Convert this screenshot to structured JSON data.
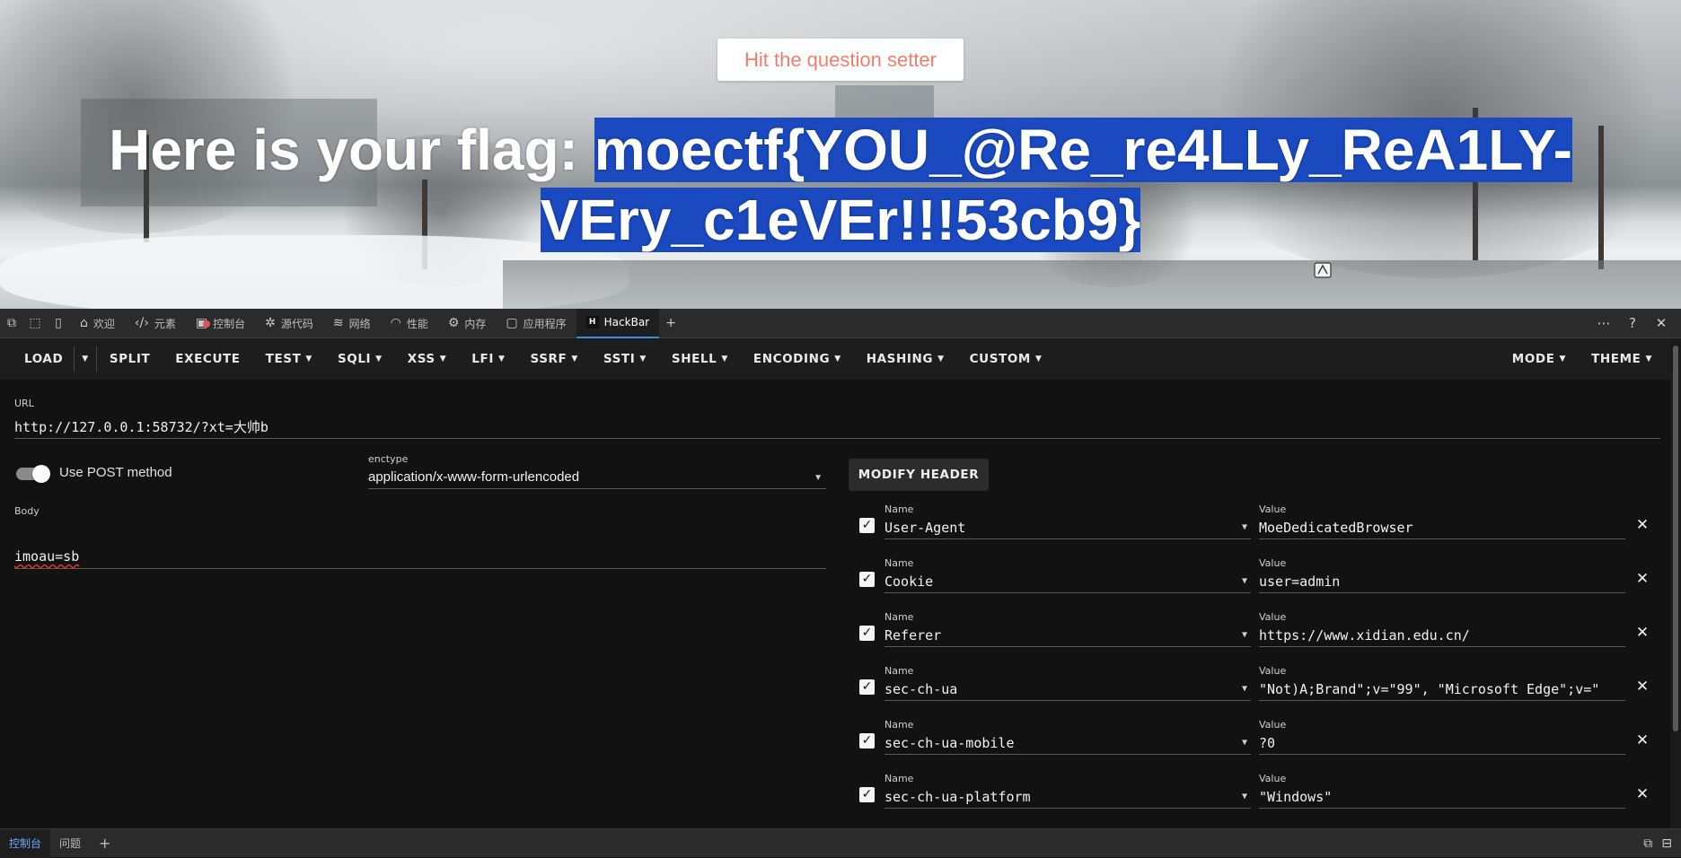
{
  "page": {
    "hit_button": "Hit the question setter",
    "flag_prefix": "Here is your flag: ",
    "flag_value_line1": "moectf{YOU_@Re_re4LLy_ReA1LY-",
    "flag_value_line2": "VEry_c1eVEr!!!53cb9}"
  },
  "devtools": {
    "tabs": [
      {
        "label": "欢迎",
        "icon": "home-icon"
      },
      {
        "label": "元素",
        "icon": "elements-icon"
      },
      {
        "label": "控制台",
        "icon": "console-icon"
      },
      {
        "label": "源代码",
        "icon": "sources-icon"
      },
      {
        "label": "网络",
        "icon": "wifi-icon"
      },
      {
        "label": "性能",
        "icon": "performance-icon"
      },
      {
        "label": "内存",
        "icon": "memory-icon"
      },
      {
        "label": "应用程序",
        "icon": "application-icon"
      },
      {
        "label": "HackBar",
        "icon": "hackbar-icon"
      }
    ],
    "active_tab": "HackBar"
  },
  "toolbar": {
    "load": "LOAD",
    "split": "SPLIT",
    "execute": "EXECUTE",
    "test": "TEST",
    "sqli": "SQLI",
    "xss": "XSS",
    "lfi": "LFI",
    "ssrf": "SSRF",
    "ssti": "SSTI",
    "shell": "SHELL",
    "encoding": "ENCODING",
    "hashing": "HASHING",
    "custom": "CUSTOM",
    "mode": "MODE",
    "theme": "THEME"
  },
  "form": {
    "url_label": "URL",
    "url_value": "http://127.0.0.1:58732/?xt=大帅b",
    "post_label": "Use POST method",
    "post_enabled": true,
    "enctype_label": "enctype",
    "enctype_value": "application/x-www-form-urlencoded",
    "body_label": "Body",
    "body_value": "imoau=sb",
    "modify_header": "MODIFY HEADER"
  },
  "headers": {
    "name_label": "Name",
    "value_label": "Value",
    "rows": [
      {
        "name": "User-Agent",
        "value": "MoeDedicatedBrowser",
        "checked": true
      },
      {
        "name": "Cookie",
        "value": "user=admin",
        "checked": true
      },
      {
        "name": "Referer",
        "value": "https://www.xidian.edu.cn/",
        "checked": true
      },
      {
        "name": "sec-ch-ua",
        "value": "\"Not)A;Brand\";v=\"99\", \"Microsoft Edge\";v=\"",
        "checked": true
      },
      {
        "name": "sec-ch-ua-mobile",
        "value": "?0",
        "checked": true
      },
      {
        "name": "sec-ch-ua-platform",
        "value": "\"Windows\"",
        "checked": true
      }
    ]
  },
  "drawer": {
    "tabs": [
      "控制台",
      "问题"
    ],
    "active_tab": "控制台"
  }
}
